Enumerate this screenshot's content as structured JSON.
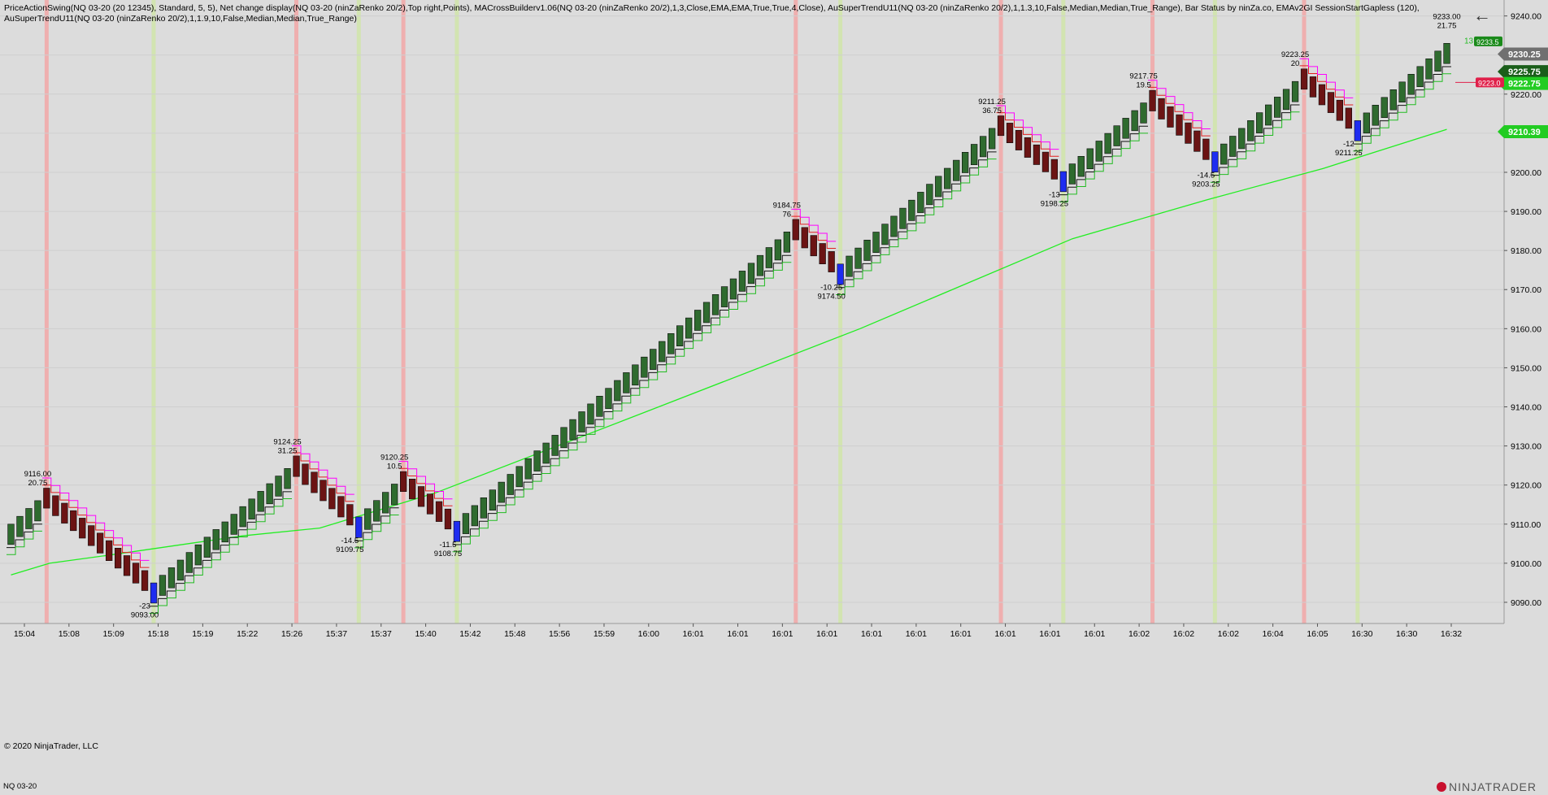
{
  "header": {
    "line1": "PriceActionSwing(NQ 03-20 (20 12345), Standard, 5, 5), Net change display(NQ 03-20 (ninZaRenko 20/2),Top right,Points), MACrossBuilderv1.06(NQ 03-20 (ninZaRenko 20/2),1,3,Close,EMA,EMA,True,True,4,Close), AuSuperTrendU11(NQ 03-20 (ninZaRenko 20/2),1,1.3,10,False,Median,Median,True_Range), Bar Status by ninZa.co, EMAv2GI SessionStartGapless (120),",
    "line2": "AuSuperTrendU11(NQ 03-20 (ninZaRenko 20/2),1,1.9,10,False,Median,Median,True_Range)"
  },
  "copyright": "© 2020 NinjaTrader, LLC",
  "instrument": "NQ 03-20",
  "brand": "NINJATRADER",
  "colors": {
    "background": "#dcdcdc",
    "up_bar": "#2f6b2f",
    "down_bar": "#6b1414",
    "ema": "#22ee22",
    "trend1": "#111111",
    "trend2": "#22bb22",
    "upper_magenta": "#ff00ff",
    "upper_red": "#e02020",
    "stripe_red": "#f4a4a4",
    "stripe_green": "#cfe6a6"
  },
  "chart_data": {
    "type": "bar",
    "subtype": "renko",
    "ylim": [
      9085,
      9242
    ],
    "y_ticks": [
      "9240.00",
      "9230.00",
      "9220.00",
      "9210.00",
      "9200.00",
      "9190.00",
      "9180.00",
      "9170.00",
      "9160.00",
      "9150.00",
      "9140.00",
      "9130.00",
      "9120.00",
      "9110.00",
      "9100.00",
      "9090.00"
    ],
    "x_tick_labels": [
      "15:04",
      "15:08",
      "15:09",
      "15:18",
      "15:19",
      "15:22",
      "15:26",
      "15:37",
      "15:37",
      "15:40",
      "15:42",
      "15:48",
      "15:56",
      "15:59",
      "16:00",
      "16:01",
      "16:01",
      "16:01",
      "16:01",
      "16:01",
      "16:01",
      "16:01",
      "16:01",
      "16:01",
      "16:01",
      "16:02",
      "16:02",
      "16:02",
      "16:04",
      "16:05",
      "16:30",
      "16:30",
      "16:32"
    ],
    "renko_brick_size": 2,
    "segments": [
      {
        "dir": "up",
        "from": 9108,
        "to": 9116
      },
      {
        "dir": "down",
        "from": 9116,
        "to": 9093
      },
      {
        "dir": "up",
        "from": 9093,
        "to": 9124.25
      },
      {
        "dir": "down",
        "from": 9124.25,
        "to": 9109.75
      },
      {
        "dir": "up",
        "from": 9109.75,
        "to": 9120.25
      },
      {
        "dir": "down",
        "from": 9120.25,
        "to": 9108.75
      },
      {
        "dir": "up",
        "from": 9108.75,
        "to": 9184.75
      },
      {
        "dir": "down",
        "from": 9184.75,
        "to": 9174.5
      },
      {
        "dir": "up",
        "from": 9174.5,
        "to": 9211.25
      },
      {
        "dir": "down",
        "from": 9211.25,
        "to": 9198.25
      },
      {
        "dir": "up",
        "from": 9198.25,
        "to": 9217.75
      },
      {
        "dir": "down",
        "from": 9217.75,
        "to": 9203.25
      },
      {
        "dir": "up",
        "from": 9203.25,
        "to": 9223.25
      },
      {
        "dir": "down",
        "from": 9223.25,
        "to": 9211.25
      },
      {
        "dir": "up",
        "from": 9211.25,
        "to": 9233
      }
    ],
    "swing_labels": [
      {
        "type": "high",
        "price": "9116.00",
        "change": "20.75"
      },
      {
        "type": "low",
        "price": "9093.00",
        "change": "-23"
      },
      {
        "type": "high",
        "price": "9124.25",
        "change": "31.25"
      },
      {
        "type": "low",
        "price": "9109.75",
        "change": "-14.5"
      },
      {
        "type": "high",
        "price": "9120.25",
        "change": "10.5"
      },
      {
        "type": "low",
        "price": "9108.75",
        "change": "-11.5"
      },
      {
        "type": "high",
        "price": "9184.75",
        "change": "76"
      },
      {
        "type": "low",
        "price": "9174.50",
        "change": "-10.25"
      },
      {
        "type": "high",
        "price": "9211.25",
        "change": "36.75"
      },
      {
        "type": "low",
        "price": "9198.25",
        "change": "-13"
      },
      {
        "type": "high",
        "price": "9217.75",
        "change": "19.5"
      },
      {
        "type": "low",
        "price": "9203.25",
        "change": "-14.5"
      },
      {
        "type": "high",
        "price": "9223.25",
        "change": "20"
      },
      {
        "type": "low",
        "price": "9211.25",
        "change": "-12"
      },
      {
        "type": "high",
        "price": "9233.00",
        "change": "21.75"
      }
    ],
    "ema_points": [
      {
        "i": 0,
        "y": 9097
      },
      {
        "i": 10,
        "y": 9100
      },
      {
        "i": 25,
        "y": 9102
      },
      {
        "i": 60,
        "y": 9107
      },
      {
        "i": 80,
        "y": 9109
      },
      {
        "i": 110,
        "y": 9118
      },
      {
        "i": 160,
        "y": 9137
      },
      {
        "i": 220,
        "y": 9160
      },
      {
        "i": 275,
        "y": 9183
      },
      {
        "i": 310,
        "y": 9193
      },
      {
        "i": 340,
        "y": 9201
      },
      {
        "i": 372,
        "y": 9211
      }
    ],
    "price_markers": [
      {
        "label": "9230.25",
        "value": 9230.25,
        "color": "#707070"
      },
      {
        "label": "9225.75",
        "value": 9225.75,
        "color": "#1a5e1a"
      },
      {
        "label": "9222.75",
        "value": 9222.75,
        "color": "#22cc22"
      },
      {
        "label": "9210.39",
        "value": 9210.39,
        "color": "#22cc22"
      }
    ],
    "side_markers": [
      {
        "label": "13",
        "value": 9233.75,
        "color": "#22bb22"
      },
      {
        "label": "9233.5",
        "value": 9233.5,
        "color": "#1a8a1a"
      },
      {
        "label": "9223.0",
        "value": 9223,
        "color": "#e0204a"
      }
    ]
  }
}
